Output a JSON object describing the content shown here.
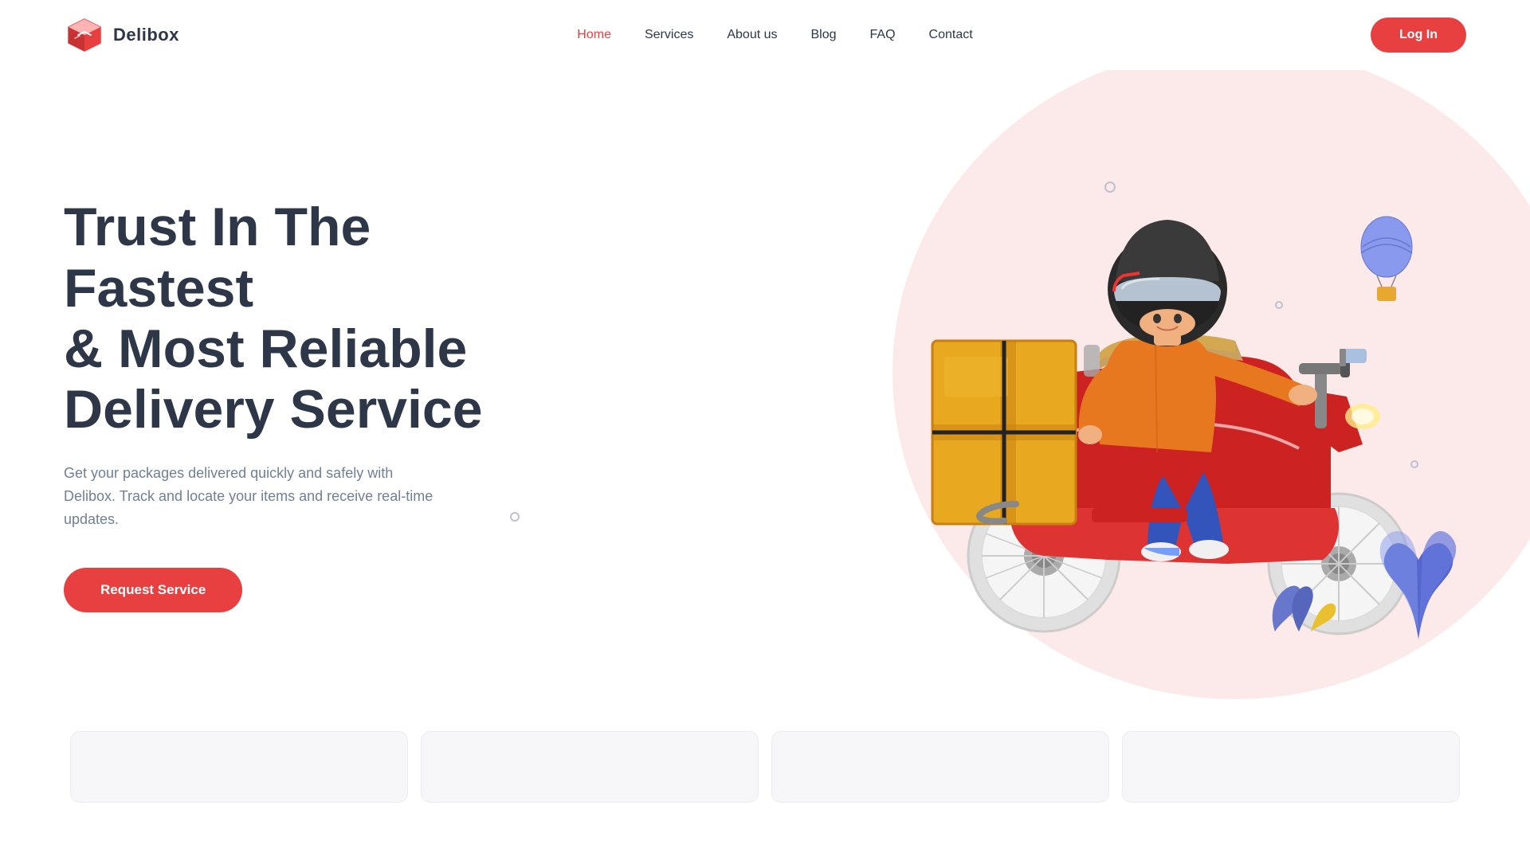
{
  "brand": {
    "name": "Delibox",
    "logo_alt": "Delibox Logo"
  },
  "nav": {
    "links": [
      {
        "label": "Home",
        "active": true
      },
      {
        "label": "Services",
        "active": false
      },
      {
        "label": "About us",
        "active": false
      },
      {
        "label": "Blog",
        "active": false
      },
      {
        "label": "FAQ",
        "active": false
      },
      {
        "label": "Contact",
        "active": false
      }
    ],
    "login_label": "Log In"
  },
  "hero": {
    "title_line1": "Trust In The Fastest",
    "title_line2": "& Most Reliable",
    "title_line3": "Delivery Service",
    "subtitle": "Get your packages delivered quickly and safely with Delibox. Track and locate your items and receive real-time updates.",
    "cta_label": "Request Service"
  },
  "colors": {
    "brand_red": "#e84040",
    "dark_text": "#2d3748",
    "muted_text": "#718096",
    "bg_blob": "#fce9e9"
  }
}
